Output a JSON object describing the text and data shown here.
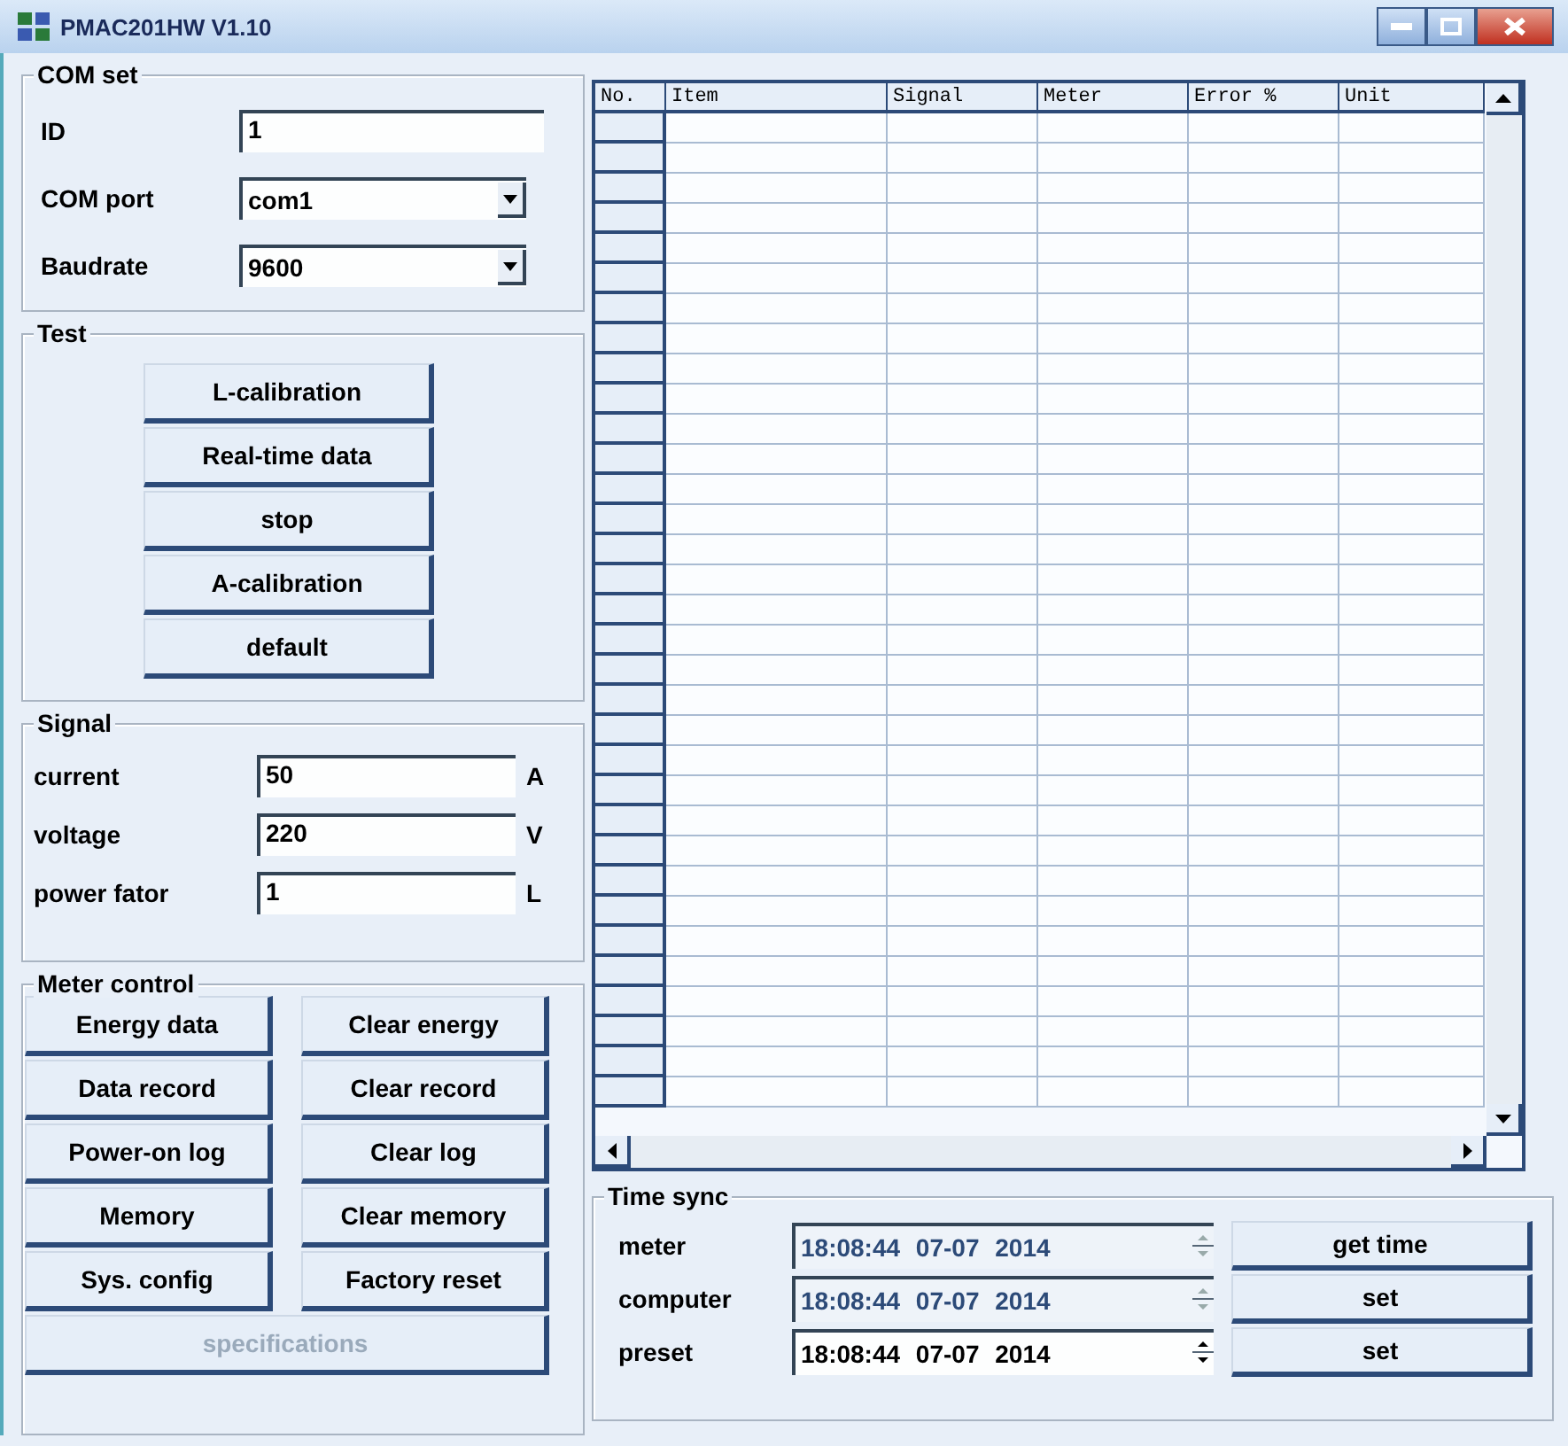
{
  "window": {
    "title": "PMAC201HW V1.10"
  },
  "com_set": {
    "title": "COM set",
    "fields": [
      {
        "kind": "text",
        "label": "ID",
        "value": "1"
      },
      {
        "kind": "combo",
        "label": "COM port",
        "value": "com1"
      },
      {
        "kind": "combo",
        "label": "Baudrate",
        "value": "9600"
      }
    ]
  },
  "test": {
    "title": "Test",
    "buttons": [
      "L-calibration",
      "Real-time data",
      "stop",
      "A-calibration",
      "default"
    ]
  },
  "signal": {
    "title": "Signal",
    "fields": [
      {
        "label": "current",
        "value": "50",
        "unit": "A"
      },
      {
        "label": "voltage",
        "value": "220",
        "unit": "V"
      },
      {
        "label": "power fator",
        "value": "1",
        "unit": "L"
      }
    ]
  },
  "meter_control": {
    "title": "Meter control",
    "buttons": [
      {
        "label": "Energy data",
        "disabled": false
      },
      {
        "label": "Clear energy",
        "disabled": false
      },
      {
        "label": "Data record",
        "disabled": false
      },
      {
        "label": "Clear record",
        "disabled": false
      },
      {
        "label": "Power-on log",
        "disabled": false
      },
      {
        "label": "Clear log",
        "disabled": false
      },
      {
        "label": "Memory",
        "disabled": false
      },
      {
        "label": "Clear memory",
        "disabled": false
      },
      {
        "label": "Sys. config",
        "disabled": false
      },
      {
        "label": "Factory reset",
        "disabled": false
      },
      {
        "label": "specifications",
        "disabled": true
      }
    ]
  },
  "table": {
    "columns": [
      "No.",
      "Item",
      "Signal",
      "Meter",
      "Error %",
      "Unit"
    ]
  },
  "time_sync": {
    "title": "Time sync",
    "rows": [
      {
        "label": "meter",
        "value": "18:08:44 07-07 2014",
        "disabled": true,
        "button": "get time"
      },
      {
        "label": "computer",
        "value": "18:08:44 07-07 2014",
        "disabled": true,
        "button": "set"
      },
      {
        "label": "preset",
        "value": "18:08:44 07-07 2014",
        "disabled": false,
        "button": "set"
      }
    ]
  }
}
